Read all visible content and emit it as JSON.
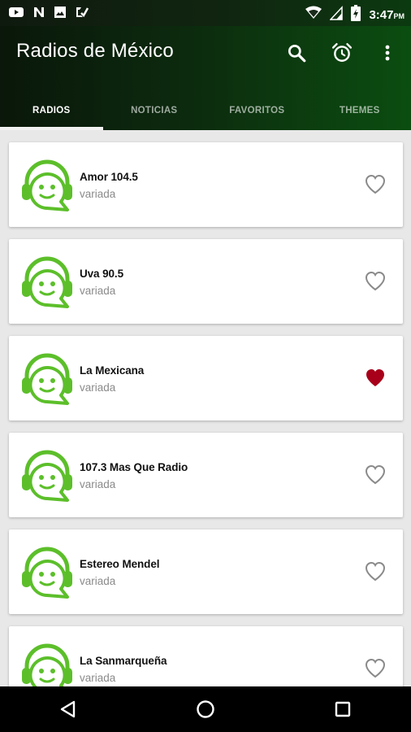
{
  "status_bar": {
    "time": "3:47",
    "ampm": "PM",
    "notification_icons": [
      "youtube-icon",
      "n-app-icon",
      "image-icon",
      "download-check-icon"
    ],
    "system_icons": [
      "wifi-icon",
      "signal-icon",
      "battery-charging-icon"
    ]
  },
  "app_bar": {
    "title": "Radios de México",
    "actions": [
      "search-icon",
      "alarm-icon",
      "more-vert-icon"
    ]
  },
  "tabs": [
    {
      "label": "RADIOS",
      "active": true
    },
    {
      "label": "NOTICIAS",
      "active": false
    },
    {
      "label": "FAVORITOS",
      "active": false
    },
    {
      "label": "THEMES",
      "active": false
    }
  ],
  "stations": [
    {
      "name": "Amor 104.5",
      "genre": "variada",
      "favorite": false
    },
    {
      "name": "Uva 90.5",
      "genre": "variada",
      "favorite": false
    },
    {
      "name": "La Mexicana",
      "genre": "variada",
      "favorite": true
    },
    {
      "name": "107.3 Mas Que Radio",
      "genre": "variada",
      "favorite": false
    },
    {
      "name": "Estereo Mendel",
      "genre": "variada",
      "favorite": false
    },
    {
      "name": "La Sanmarqueña",
      "genre": "variada",
      "favorite": false
    }
  ],
  "colors": {
    "logo_green": "#5cbf2a",
    "favorite_red": "#a8001a",
    "heart_outline": "#8a8a8a",
    "app_bar_dark": "#0a170a",
    "app_bar_green": "#0b4d10"
  },
  "nav_bar": [
    "back-icon",
    "home-icon",
    "recents-icon"
  ]
}
